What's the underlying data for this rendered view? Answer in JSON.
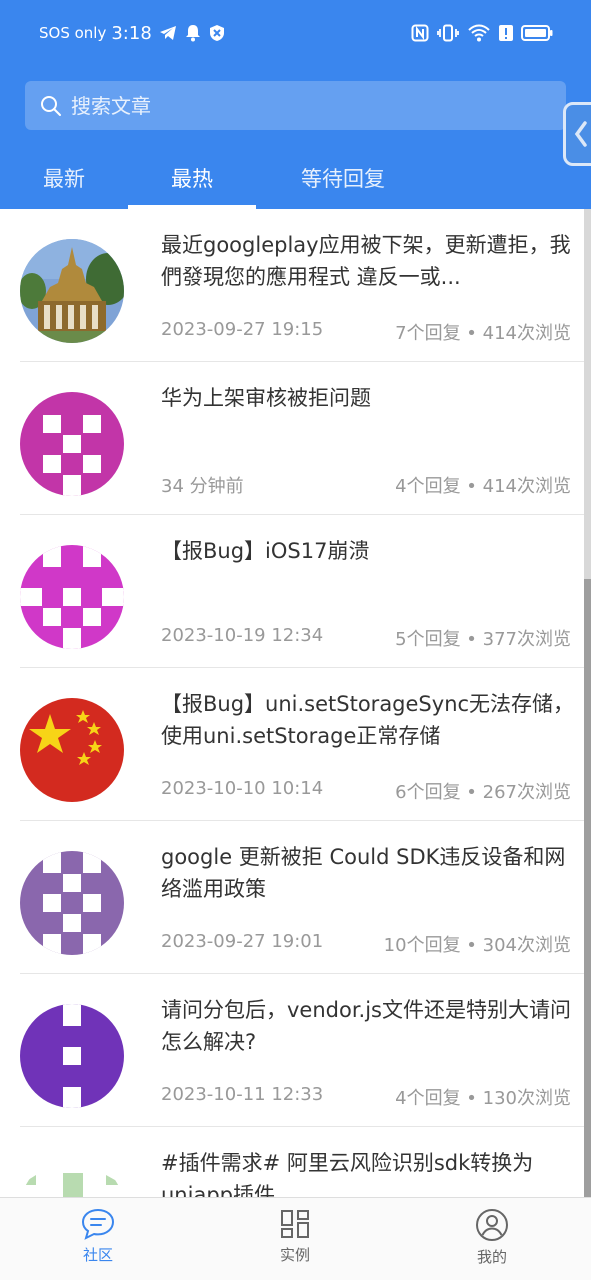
{
  "status_bar": {
    "carrier": "SOS only",
    "time": "3:18"
  },
  "search": {
    "placeholder": "搜索文章"
  },
  "tabs": [
    {
      "label": "最新",
      "active": false
    },
    {
      "label": "最热",
      "active": true
    },
    {
      "label": "等待回复",
      "active": false
    }
  ],
  "posts": [
    {
      "title": "最近googleplay应用被下架，更新遭拒，我們發現您的應用程式 違反一或...",
      "time": "2023-09-27 19:15",
      "stats": "7个回复 • 414次浏览",
      "avatar": "photo-temple"
    },
    {
      "title": "华为上架审核被拒问题",
      "time": "34 分钟前",
      "stats": "4个回复 • 414次浏览",
      "avatar": "identicon-magenta"
    },
    {
      "title": "【报Bug】iOS17崩溃",
      "time": "2023-10-19 12:34",
      "stats": "5个回复 • 377次浏览",
      "avatar": "identicon-pink"
    },
    {
      "title": "【报Bug】uni.setStorageSync无法存储，使用uni.setStorage正常存储",
      "time": "2023-10-10 10:14",
      "stats": "6个回复 • 267次浏览",
      "avatar": "flag-china"
    },
    {
      "title": "google 更新被拒 Could SDK违反设备和网络滥用政策",
      "time": "2023-09-27 19:01",
      "stats": "10个回复 • 304次浏览",
      "avatar": "identicon-purple"
    },
    {
      "title": "请问分包后，vendor.js文件还是特别大请问怎么解决?",
      "time": "2023-10-11 12:33",
      "stats": "4个回复 • 130次浏览",
      "avatar": "identicon-violet"
    },
    {
      "title": "#插件需求# 阿里云风险识别sdk转换为uniapp插件",
      "time": "",
      "stats": "",
      "avatar": "identicon-green"
    }
  ],
  "bottom_nav": [
    {
      "label": "社区",
      "icon": "chat-bubble-icon",
      "active": true
    },
    {
      "label": "实例",
      "icon": "grid-icon",
      "active": false
    },
    {
      "label": "我的",
      "icon": "user-icon",
      "active": false
    }
  ],
  "colors": {
    "primary": "#3a86ee",
    "text": "#333333",
    "muted": "#999999"
  }
}
